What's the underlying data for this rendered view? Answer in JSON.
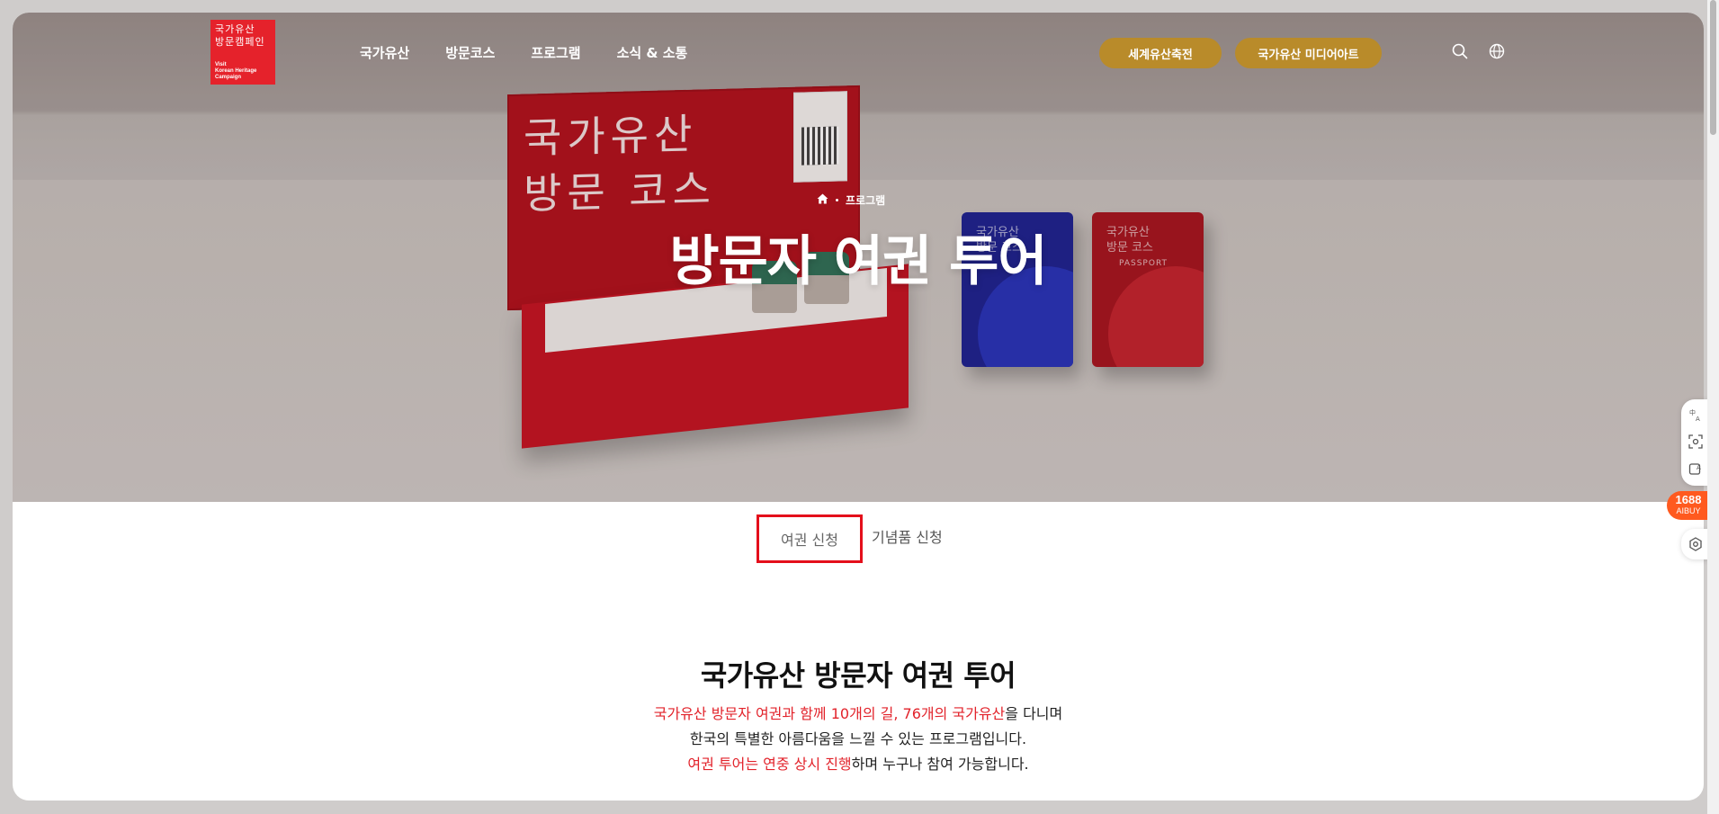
{
  "header": {
    "logo_ko": "국가유산\n방문캠페인",
    "logo_en": "Visit\nKorean Heritage\nCampaign",
    "nav": [
      "국가유산",
      "방문코스",
      "프로그램",
      "소식 & 소통"
    ],
    "pill_buttons": [
      "세계유산축전",
      "국가유산 미디어아트"
    ],
    "icons": [
      "search-icon",
      "globe-icon"
    ],
    "accent_color": "#b98b2a"
  },
  "hero": {
    "breadcrumb": [
      "home-icon",
      "프로그램"
    ],
    "breadcrumb_text": "프로그램",
    "title": "방문자 여권 투어",
    "box_lid_text": "국가유산\n방문 코스",
    "passport_text": "국가유산\n방문 코스",
    "passport_label": "PASSPORT"
  },
  "tabs": {
    "items": [
      "여권 신청",
      "기념품 신청"
    ],
    "active": "여권 신청",
    "highlight_color": "#e40f1b"
  },
  "intro": {
    "title": "국가유산 방문자 여권 투어",
    "line1_red": "국가유산 방문자 여권과 함께 10개의 길, 76개의 국가유산",
    "line1_rest": "을 다니며",
    "line2": "한국의 특별한 아름다움을 느낄 수 있는 프로그램입니다.",
    "line3_red": "여권 투어는 연중 상시 진행",
    "line3_rest": "하며 누구나 참여 가능합니다.",
    "accent_red": "#e2232b"
  },
  "floating": {
    "badge_number": "1688",
    "badge_sub": "AIBUY",
    "icons": [
      "translate-icon",
      "screenshot-icon",
      "ai-icon",
      "settings-icon"
    ]
  }
}
